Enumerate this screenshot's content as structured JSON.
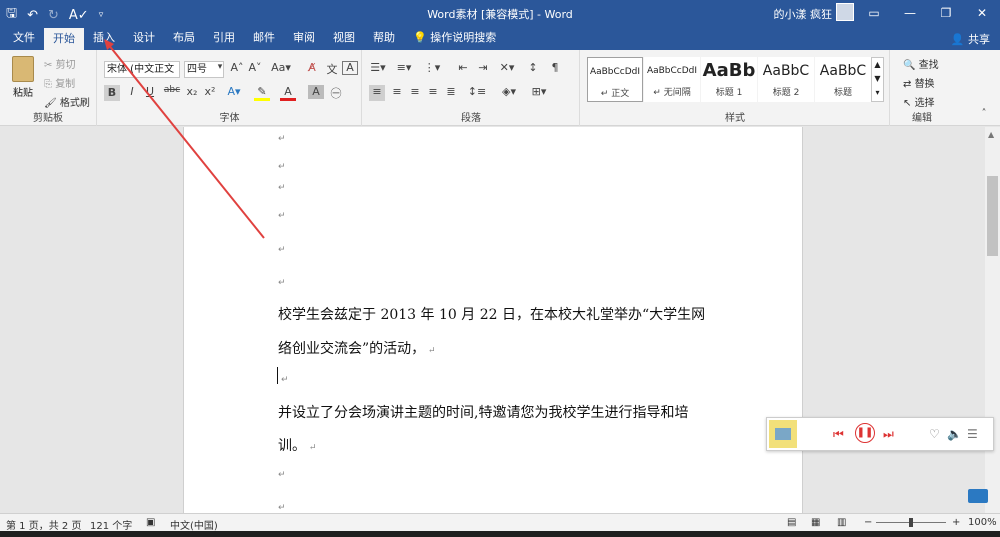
{
  "titlebar": {
    "title": "Word素材 [兼容模式] - Word",
    "user": "的小漾 疯狂",
    "win_buttons": [
      "▭",
      "—",
      "❐",
      "✕"
    ]
  },
  "tabs": [
    "文件",
    "开始",
    "插入",
    "设计",
    "布局",
    "引用",
    "邮件",
    "审阅",
    "视图",
    "帮助",
    "操作说明搜索"
  ],
  "share_label": "共享",
  "clipboard": {
    "paste": "粘贴",
    "cut": "剪切",
    "copy": "复制",
    "format_painter": "格式刷",
    "label": "剪贴板"
  },
  "font": {
    "name": "宋体 (中文正文",
    "size": "四号",
    "label": "字体"
  },
  "paragraph": {
    "label": "段落"
  },
  "styles": {
    "items": [
      {
        "preview": "AaBbCcDdI",
        "name": "↵ 正文"
      },
      {
        "preview": "AaBbCcDdI",
        "name": "↵ 无间隔"
      },
      {
        "preview": "AaBb",
        "name": "标题 1"
      },
      {
        "preview": "AaBbC",
        "name": "标题 2"
      },
      {
        "preview": "AaBbC",
        "name": "标题"
      }
    ],
    "label": "样式"
  },
  "editing": {
    "find": "查找",
    "replace": "替换",
    "select": "选择",
    "label": "编辑"
  },
  "document": {
    "para1_line1": "校学生会兹定于 2013 年 10 月 22 日，在本校大礼堂举办“大学生网",
    "para1_line2": "络创业交流会”的活动，",
    "para2_line1": "并设立了分会场演讲主题的时间,特邀请您为我校学生进行指导和培",
    "para2_line2": "训。"
  },
  "status": {
    "page": "第 1 页，共 2 页",
    "words": "121 个字",
    "lang": "中文(中国)",
    "zoom": "100%"
  },
  "colors": {
    "brand": "#2b579a",
    "arrow": "#e0413f"
  }
}
